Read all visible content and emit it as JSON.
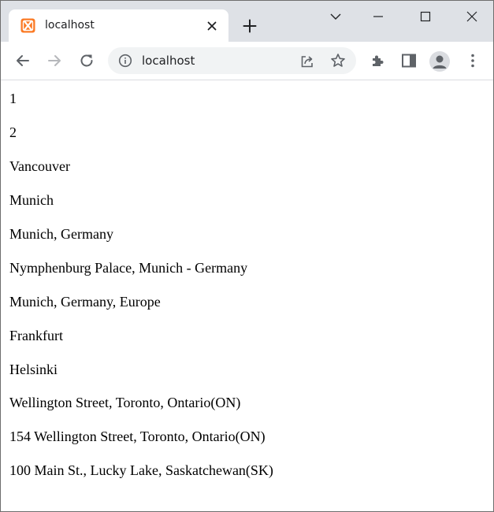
{
  "browser": {
    "tab_title": "localhost",
    "url": "localhost",
    "tab_favicon": "xampp-icon",
    "icons": {
      "back": "arrow-left-icon",
      "forward": "arrow-right-icon",
      "reload": "reload-icon",
      "info": "info-icon",
      "share": "share-icon",
      "bookmark": "star-icon",
      "extensions": "puzzle-icon",
      "side_panel": "side-panel-icon",
      "profile": "avatar-icon",
      "menu": "kebab-menu-icon",
      "new_tab": "plus-icon",
      "tab_close": "close-icon",
      "tab_search": "chevron-down-icon",
      "minimize": "minimize-icon",
      "maximize": "maximize-icon",
      "close_window": "close-icon"
    },
    "colors": {
      "tabstrip": "#dee1e6",
      "omnibox": "#f1f3f4",
      "favicon": "#fb7a24"
    }
  },
  "page": {
    "lines": [
      "1",
      "2",
      "Vancouver",
      "Munich",
      "Munich, Germany",
      "Nymphenburg Palace, Munich - Germany",
      "Munich, Germany, Europe",
      "Frankfurt",
      "Helsinki",
      "Wellington Street, Toronto, Ontario(ON)",
      "154 Wellington Street, Toronto, Ontario(ON)",
      "100 Main St., Lucky Lake, Saskatchewan(SK)"
    ]
  }
}
